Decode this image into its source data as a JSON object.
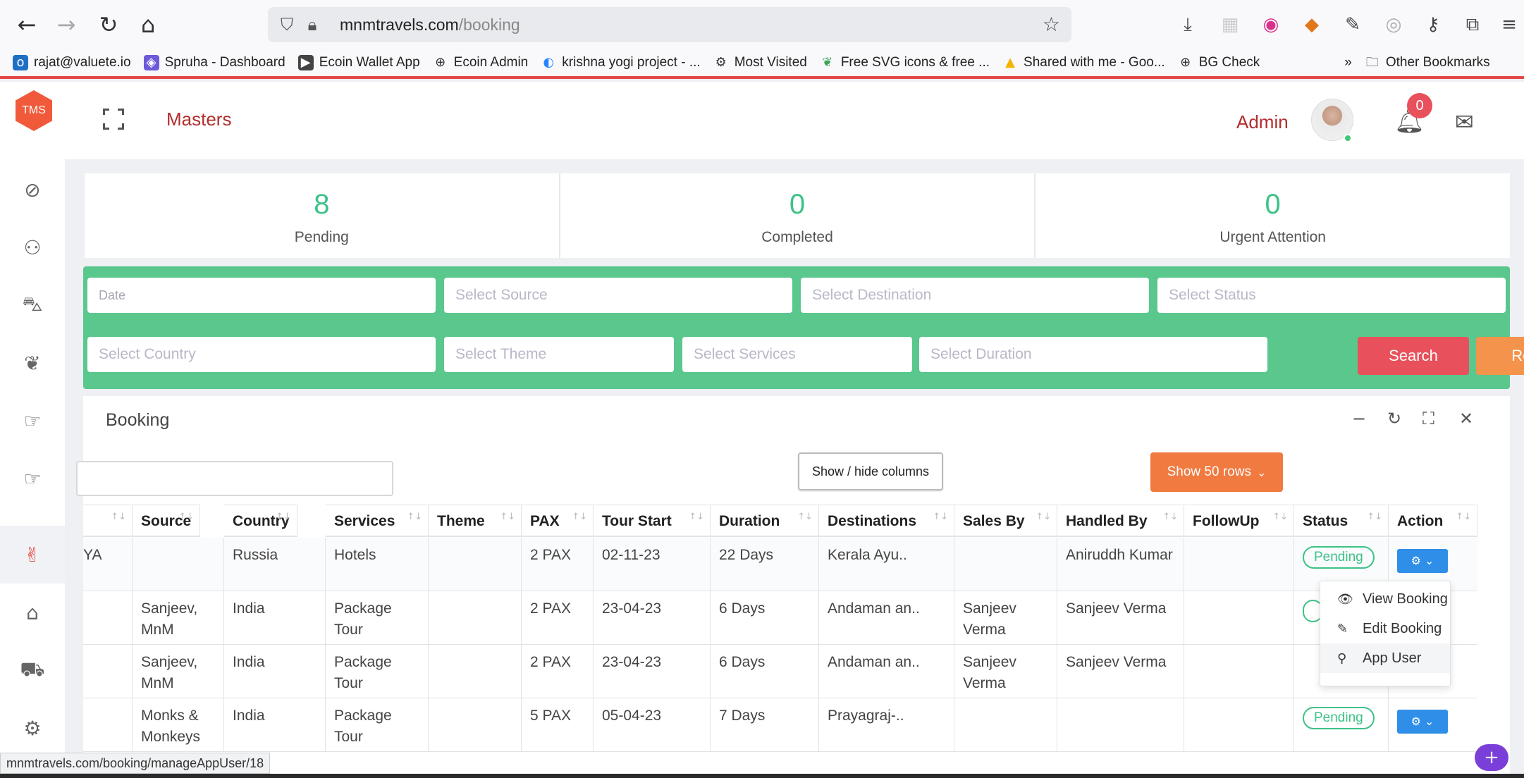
{
  "browser": {
    "url_host": "mnmtravels.com",
    "url_path": "/booking",
    "status_url": "mnmtravels.com/booking/manageAppUser/18",
    "bookmarks": [
      {
        "label": "rajat@valuete.io",
        "icon": "outlook-icon",
        "color": "#1f6fc5"
      },
      {
        "label": "Spruha - Dashboard",
        "icon": "spruha-icon",
        "color": "#6d5ad8"
      },
      {
        "label": "Ecoin Wallet App",
        "icon": "ecoin-icon",
        "color": "#444444"
      },
      {
        "label": "Ecoin Admin",
        "icon": "globe-icon",
        "color": "#333333"
      },
      {
        "label": "krishna yogi project - ...",
        "icon": "jira-icon",
        "color": "#2684ff"
      },
      {
        "label": "Most Visited",
        "icon": "gear-icon",
        "color": "#333333"
      },
      {
        "label": "Free SVG icons & free ...",
        "icon": "svg-icon",
        "color": "#3ca55c"
      },
      {
        "label": "Shared with me - Goo...",
        "icon": "drive-icon",
        "color": "#f4b400"
      },
      {
        "label": "BG Check",
        "icon": "globe-icon",
        "color": "#333333"
      }
    ],
    "other_bookmarks": "Other Bookmarks"
  },
  "header": {
    "logo": "TMS",
    "section": "Masters",
    "user": "Admin",
    "notifications": "0"
  },
  "stats": [
    {
      "value": "8",
      "label": "Pending"
    },
    {
      "value": "0",
      "label": "Completed"
    },
    {
      "value": "0",
      "label": "Urgent Attention"
    }
  ],
  "filters": {
    "date": "Date",
    "source": "Select Source",
    "destination": "Select Destination",
    "status": "Select Status",
    "country": "Select Country",
    "theme": "Select Theme",
    "services": "Select Services",
    "duration": "Select Duration",
    "search": "Search",
    "reset": "Reset"
  },
  "panel": {
    "title": "Booking",
    "show_hide": "Show / hide columns",
    "show_rows": "Show 50 rows"
  },
  "table": {
    "columns": [
      "",
      "Source",
      "Country",
      "Services",
      "Theme",
      "PAX",
      "Tour Start",
      "Duration",
      "Destinations",
      "Sales By",
      "Handled By",
      "FollowUp",
      "Status",
      "Action"
    ],
    "rows": [
      {
        "c0": "YA",
        "source": "",
        "country": "Russia",
        "services": "Hotels",
        "theme": "",
        "pax": "2 PAX",
        "start": "02-11-23",
        "duration": "22 Days",
        "dest": "Kerala Ayu..",
        "sales": "",
        "handled": "Aniruddh Kumar",
        "follow": "",
        "status": "Pending"
      },
      {
        "c0": "",
        "source": "Sanjeev, MnM",
        "country": "India",
        "services": "Package Tour",
        "theme": "",
        "pax": "2 PAX",
        "start": "23-04-23",
        "duration": "6 Days",
        "dest": "Andaman an..",
        "sales": "Sanjeev Verma",
        "handled": "Sanjeev Verma",
        "follow": "",
        "status": ""
      },
      {
        "c0": "",
        "source": "Sanjeev, MnM",
        "country": "India",
        "services": "Package Tour",
        "theme": "",
        "pax": "2 PAX",
        "start": "23-04-23",
        "duration": "6 Days",
        "dest": "Andaman an..",
        "sales": "Sanjeev Verma",
        "handled": "Sanjeev Verma",
        "follow": "",
        "status": ""
      },
      {
        "c0": "",
        "source": "Monks & Monkeys",
        "country": "India",
        "services": "Package Tour",
        "theme": "",
        "pax": "5 PAX",
        "start": "05-04-23",
        "duration": "7 Days",
        "dest": "Prayagraj-..",
        "sales": "",
        "handled": "",
        "follow": "",
        "status": "Pending"
      }
    ]
  },
  "action_menu": [
    "View Booking",
    "Edit Booking",
    "App User"
  ]
}
